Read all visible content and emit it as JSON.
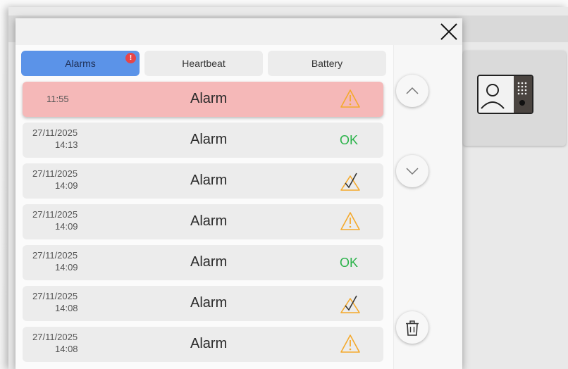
{
  "tabs": [
    {
      "label": "Alarms",
      "active": true,
      "badge": "!"
    },
    {
      "label": "Heartbeat",
      "active": false
    },
    {
      "label": "Battery",
      "active": false
    }
  ],
  "alarm_rows": [
    {
      "date": "",
      "time": "11:55",
      "label": "Alarm",
      "status": "warning-icon",
      "highlight": true
    },
    {
      "date": "27/11/2025",
      "time": "14:13",
      "label": "Alarm",
      "status": "OK"
    },
    {
      "date": "27/11/2025",
      "time": "14:09",
      "label": "Alarm",
      "status": "acknowledged-icon"
    },
    {
      "date": "27/11/2025",
      "time": "14:09",
      "label": "Alarm",
      "status": "warning-icon"
    },
    {
      "date": "27/11/2025",
      "time": "14:09",
      "label": "Alarm",
      "status": "OK"
    },
    {
      "date": "27/11/2025",
      "time": "14:08",
      "label": "Alarm",
      "status": "acknowledged-icon"
    },
    {
      "date": "27/11/2025",
      "time": "14:08",
      "label": "Alarm",
      "status": "warning-icon"
    }
  ],
  "colors": {
    "accent_tab": "#5b93e8",
    "highlight_row": "#f5b8b8",
    "warning": "#f4a92c",
    "ok": "#2bb34a",
    "badge": "#e74548"
  },
  "controls": [
    "close-icon",
    "chevron-up-icon",
    "chevron-down-icon",
    "trash-icon"
  ],
  "background_card_icon": "intercom-door-station-icon"
}
